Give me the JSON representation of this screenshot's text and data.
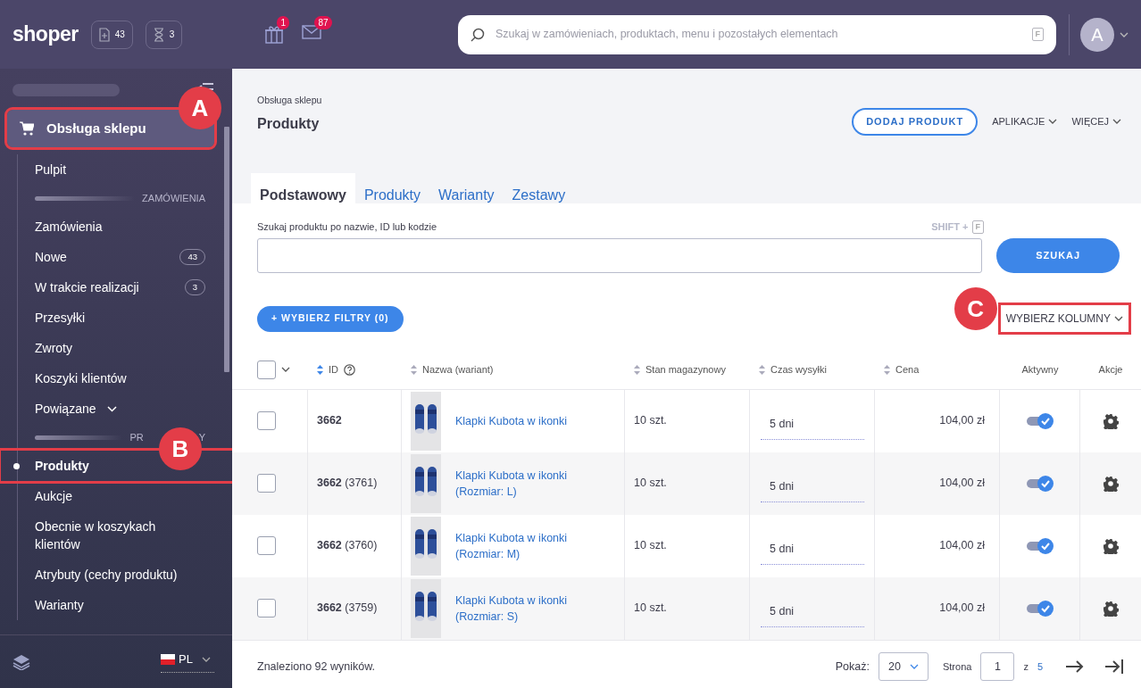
{
  "topbar": {
    "logo": "shoper",
    "chips": [
      {
        "kind": "new",
        "count": "43"
      },
      {
        "kind": "pending",
        "count": "3"
      }
    ],
    "notifications": [
      {
        "kind": "gift",
        "badge": "1"
      },
      {
        "kind": "mail",
        "badge": "87"
      }
    ],
    "search": {
      "placeholder": "Szukaj w zamówieniach, produktach, menu i pozostałych elementach",
      "shortcut": "F"
    },
    "avatar": "A"
  },
  "sidebar": {
    "section_title": "Obsługa sklepu",
    "items": [
      {
        "kind": "item",
        "label": "Pulpit",
        "selected": false
      },
      {
        "kind": "section",
        "label": "ZAMÓWIENIA"
      },
      {
        "kind": "item",
        "label": "Zamówienia",
        "selected": false
      },
      {
        "kind": "item",
        "label": "Nowe",
        "badge": "43",
        "selected": false
      },
      {
        "kind": "item",
        "label": "W trakcie realizacji",
        "badge": "3",
        "selected": false
      },
      {
        "kind": "item",
        "label": "Przesyłki",
        "selected": false
      },
      {
        "kind": "item",
        "label": "Zwroty",
        "selected": false
      },
      {
        "kind": "item",
        "label": "Koszyki klientów",
        "selected": false
      },
      {
        "kind": "group",
        "label": "Powiązane",
        "expanded": false
      },
      {
        "kind": "section",
        "label": "PR",
        "label_end": "Y"
      },
      {
        "kind": "item",
        "label": "Produkty",
        "selected": true
      },
      {
        "kind": "item",
        "label": "Aukcje",
        "selected": false
      },
      {
        "kind": "item",
        "label": "Obecnie w koszykach klientów",
        "selected": false
      },
      {
        "kind": "item",
        "label": "Atrybuty (cechy produktu)",
        "selected": false
      },
      {
        "kind": "item",
        "label": "Warianty",
        "selected": false
      }
    ],
    "language": "PL"
  },
  "header": {
    "breadcrumb": "Obsługa sklepu",
    "title": "Produkty",
    "actions": [
      {
        "kind": "primary",
        "label": "DODAJ PRODUKT"
      },
      {
        "kind": "menu",
        "label": "APLIKACJE"
      },
      {
        "kind": "menu",
        "label": "WIĘCEJ"
      }
    ]
  },
  "tabs": [
    {
      "label": "Podstawowy",
      "selected": true
    },
    {
      "label": "Produkty",
      "selected": false
    },
    {
      "label": "Warianty",
      "selected": false
    },
    {
      "label": "Zestawy",
      "selected": false
    }
  ],
  "search": {
    "label": "Szukaj produktu po nazwie, ID lub kodzie",
    "shortcut_prefix": "SHIFT +",
    "shortcut_key": "F",
    "button": "SZUKAJ"
  },
  "filters_button": "+ WYBIERZ FILTRY (0)",
  "columns_button": "WYBIERZ KOLUMNY",
  "table": {
    "select_all_checked": false,
    "columns": [
      {
        "label": "ID",
        "sortable": true
      },
      {
        "label": "Nazwa (wariant)",
        "sortable": true
      },
      {
        "label": "Stan magazynowy",
        "sortable": true
      },
      {
        "label": "Czas wysyłki",
        "sortable": true
      },
      {
        "label": "Cena",
        "sortable": true
      },
      {
        "label": "Aktywny",
        "sortable": false
      },
      {
        "label": "Akcje",
        "sortable": false
      }
    ],
    "rows": [
      {
        "checked": false,
        "id": "3662",
        "name": "Klapki Kubota w ikonki",
        "stock": "10 szt.",
        "shipping": "5 dni",
        "price": "104,00 zł",
        "active": true
      },
      {
        "checked": false,
        "id": "3662",
        "variant_id": "(3761)",
        "name": "Klapki Kubota w ikonki",
        "variant": "(Rozmiar: L)",
        "stock": "10 szt.",
        "shipping": "5 dni",
        "price": "104,00 zł",
        "active": true
      },
      {
        "checked": false,
        "id": "3662",
        "variant_id": "(3760)",
        "name": "Klapki Kubota w ikonki",
        "variant": "(Rozmiar: M)",
        "stock": "10 szt.",
        "shipping": "5 dni",
        "price": "104,00 zł",
        "active": true
      },
      {
        "checked": false,
        "id": "3662",
        "variant_id": "(3759)",
        "name": "Klapki Kubota w ikonki",
        "variant": "(Rozmiar: S)",
        "stock": "10 szt.",
        "shipping": "5 dni",
        "price": "104,00 zł",
        "active": true
      }
    ]
  },
  "footer": {
    "results": "Znaleziono 92 wyników.",
    "per_page_label": "Pokaż:",
    "per_page": "20",
    "page_label": "Strona",
    "page": "1",
    "of_label": "z",
    "pages": "5"
  },
  "annotations": [
    {
      "label": "A"
    },
    {
      "label": "B"
    },
    {
      "label": "C"
    }
  ]
}
